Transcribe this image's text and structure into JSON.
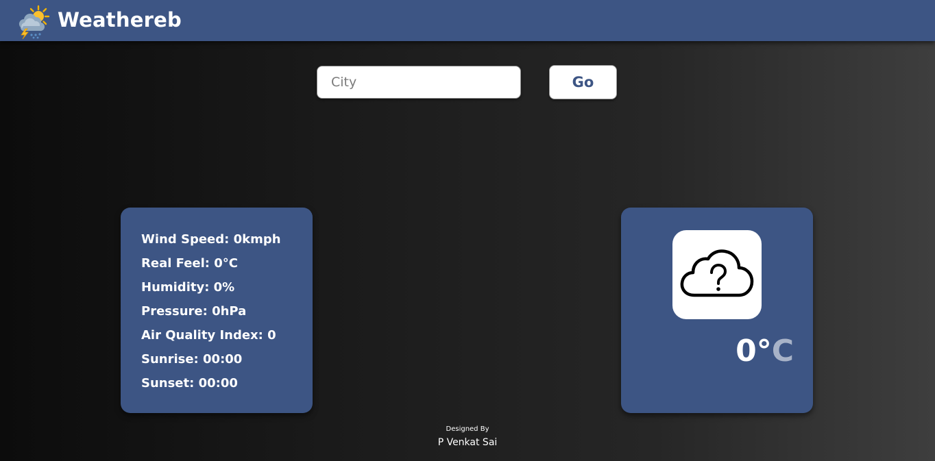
{
  "header": {
    "brand": "Weathereb",
    "logo_icon": "weather-storm-sun-icon",
    "background": "#3d5584"
  },
  "search": {
    "placeholder": "City",
    "value": "",
    "go_label": "Go"
  },
  "details": {
    "wind_speed": "Wind Speed: 0kmph",
    "real_feel": "Real Feel: 0°C",
    "humidity": "Humidity: 0%",
    "pressure": "Pressure: 0hPa",
    "air_quality": "Air Quality Index: 0",
    "sunrise": "Sunrise: 00:00",
    "sunset": "Sunset: 00:00"
  },
  "weather": {
    "icon": "cloud-question-icon",
    "temperature": "0°",
    "unit": "C"
  },
  "footer": {
    "label": "Designed By",
    "author": "P Venkat Sai"
  },
  "colors": {
    "accent": "#3d5584",
    "card": "#3d5584",
    "unit_text": "#a8b3c8"
  }
}
